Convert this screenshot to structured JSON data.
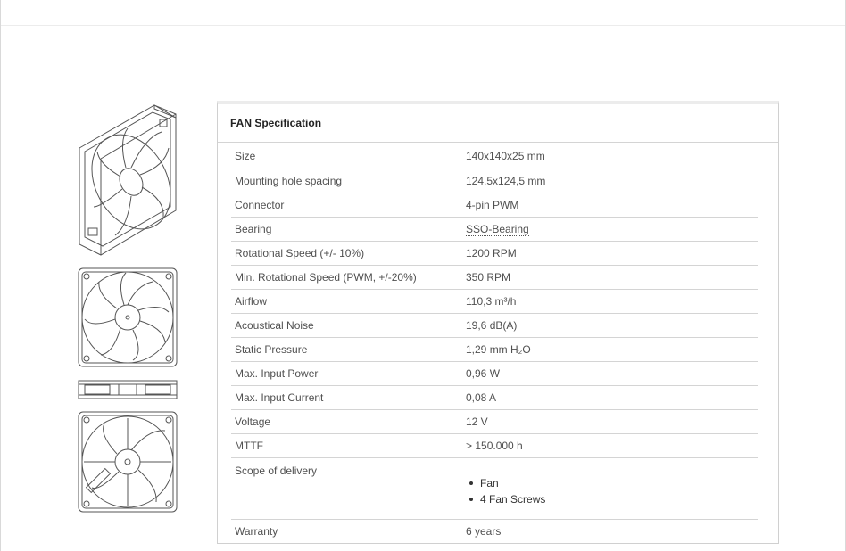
{
  "panel": {
    "title": "FAN Specification"
  },
  "images": {
    "iso": "fan-isometric-drawing",
    "front": "fan-front-drawing",
    "side": "fan-side-drawing",
    "back": "fan-back-drawing"
  },
  "specs": [
    {
      "label": "Size",
      "value": "140x140x25 mm"
    },
    {
      "label": "Mounting hole spacing",
      "value": "124,5x124,5 mm"
    },
    {
      "label": "Connector",
      "value": "4-pin PWM"
    },
    {
      "label": "Bearing",
      "value": "SSO-Bearing"
    },
    {
      "label": "Rotational Speed (+/- 10%)",
      "value": "1200 RPM"
    },
    {
      "label": "Min. Rotational Speed (PWM, +/-20%)",
      "value": "350 RPM"
    },
    {
      "label": "Airflow",
      "value": "110,3 m³/h"
    },
    {
      "label": "Acoustical Noise",
      "value": "19,6 dB(A)"
    },
    {
      "label": "Static Pressure",
      "value": "1,29 mm H₂O"
    },
    {
      "label": "Max. Input Power",
      "value": "0,96 W"
    },
    {
      "label": "Max. Input Current",
      "value": "0,08 A"
    },
    {
      "label": "Voltage",
      "value": "12 V"
    },
    {
      "label": "MTTF",
      "value": "> 150.000 h"
    }
  ],
  "scope": {
    "label": "Scope of delivery",
    "items": [
      "Fan",
      "4 Fan Screws"
    ]
  },
  "warranty": {
    "label": "Warranty",
    "value": "6 years"
  }
}
